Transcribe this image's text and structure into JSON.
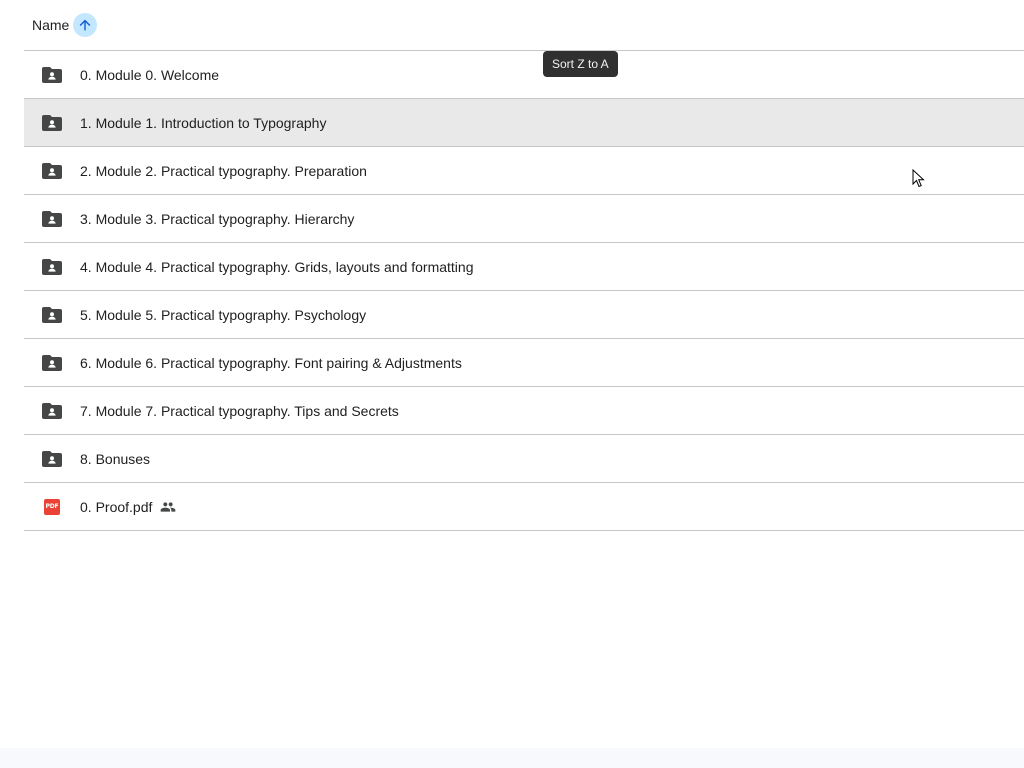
{
  "header": {
    "name_label": "Name",
    "sort_icon": "arrow-upward-icon"
  },
  "tooltip": {
    "text": "Sort Z to A"
  },
  "files": [
    {
      "name": "0. Module 0. Welcome",
      "type": "shared-folder",
      "icon": "shared-folder-icon"
    },
    {
      "name": "1. Module 1. Introduction to Typography",
      "type": "shared-folder",
      "icon": "shared-folder-icon",
      "hovered": true
    },
    {
      "name": "2. Module 2. Practical typography. Preparation",
      "type": "shared-folder",
      "icon": "shared-folder-icon"
    },
    {
      "name": "3. Module 3. Practical typography. Hierarchy",
      "type": "shared-folder",
      "icon": "shared-folder-icon"
    },
    {
      "name": "4. Module 4. Practical typography. Grids, layouts and formatting",
      "type": "shared-folder",
      "icon": "shared-folder-icon"
    },
    {
      "name": "5. Module 5. Practical typography. Psychology",
      "type": "shared-folder",
      "icon": "shared-folder-icon"
    },
    {
      "name": "6. Module 6. Practical typography. Font pairing & Adjustments",
      "type": "shared-folder",
      "icon": "shared-folder-icon"
    },
    {
      "name": "7. Module 7. Practical typography. Tips and Secrets",
      "type": "shared-folder",
      "icon": "shared-folder-icon"
    },
    {
      "name": "8. Bonuses",
      "type": "shared-folder",
      "icon": "shared-folder-icon"
    },
    {
      "name": "0. Proof.pdf",
      "type": "pdf",
      "icon": "pdf-icon",
      "pdf_badge": "PDF",
      "shared_icon": "people-icon"
    }
  ],
  "colors": {
    "sort_button_bg": "#c2e7ff",
    "row_hover": "#e9e9e9",
    "pdf_red": "#ea4335",
    "tooltip_bg": "#303030"
  }
}
